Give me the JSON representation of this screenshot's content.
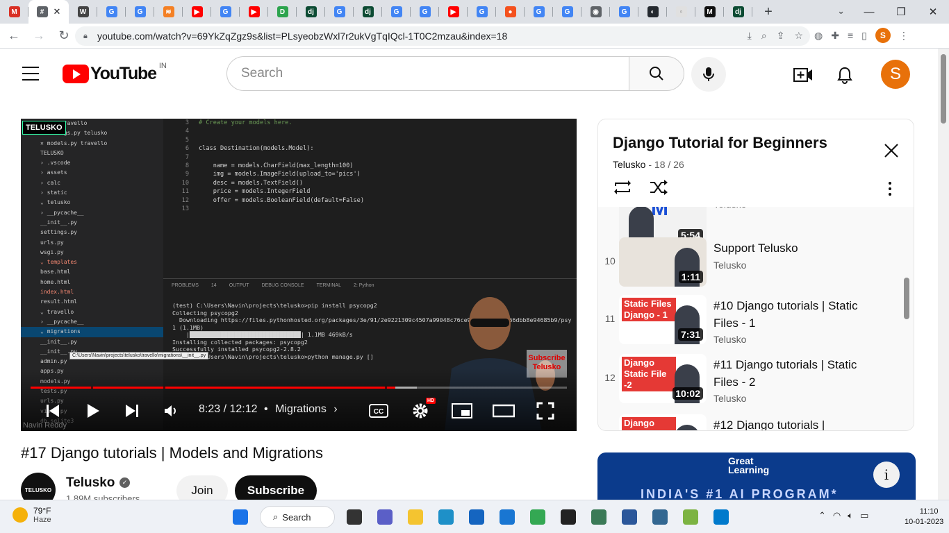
{
  "browser": {
    "tabs": [
      {
        "icon": "gmail-icon",
        "color": "#d93025",
        "glyph": "M"
      },
      {
        "icon": "hash-tab-icon",
        "color": "#5f6368",
        "glyph": "#",
        "active": true
      },
      {
        "icon": "wikipedia-icon",
        "color": "#444444",
        "glyph": "W"
      },
      {
        "icon": "google-icon",
        "color": "#4285f4",
        "glyph": "G"
      },
      {
        "icon": "google-icon",
        "color": "#4285f4",
        "glyph": "G"
      },
      {
        "icon": "stack-icon",
        "color": "#f48024",
        "glyph": "≋"
      },
      {
        "icon": "youtube-icon",
        "color": "#ff0000",
        "glyph": "▶"
      },
      {
        "icon": "google-icon",
        "color": "#4285f4",
        "glyph": "G"
      },
      {
        "icon": "youtube-icon",
        "color": "#ff0000",
        "glyph": "▶"
      },
      {
        "icon": "d-icon",
        "color": "#2da44e",
        "glyph": "D"
      },
      {
        "icon": "django-icon",
        "color": "#0c4b33",
        "glyph": "dj"
      },
      {
        "icon": "google-icon",
        "color": "#4285f4",
        "glyph": "G"
      },
      {
        "icon": "django-icon",
        "color": "#0c4b33",
        "glyph": "dj"
      },
      {
        "icon": "google-icon",
        "color": "#4285f4",
        "glyph": "G"
      },
      {
        "icon": "google-icon",
        "color": "#4285f4",
        "glyph": "G"
      },
      {
        "icon": "youtube-icon",
        "color": "#ff0000",
        "glyph": "▶"
      },
      {
        "icon": "google-icon",
        "color": "#4285f4",
        "glyph": "G"
      },
      {
        "icon": "orange-icon",
        "color": "#f4511e",
        "glyph": "●"
      },
      {
        "icon": "google-icon",
        "color": "#4285f4",
        "glyph": "G"
      },
      {
        "icon": "google-icon",
        "color": "#4285f4",
        "glyph": "G"
      },
      {
        "icon": "globe-icon",
        "color": "#5f6368",
        "glyph": "◉"
      },
      {
        "icon": "google-icon",
        "color": "#4285f4",
        "glyph": "G"
      },
      {
        "icon": "github-icon",
        "color": "#24292f",
        "glyph": "◐"
      },
      {
        "icon": "blank-page-icon",
        "color": "#e0e0e0",
        "glyph": "▫"
      },
      {
        "icon": "medium-icon",
        "color": "#111111",
        "glyph": "M"
      },
      {
        "icon": "django-icon",
        "color": "#0c4b33",
        "glyph": "dj"
      }
    ],
    "active_tab_text": "#",
    "url": "youtube.com/watch?v=69YkZqZgz9s&list=PLsyeobzWxl7r2ukVgTqIQcl-1T0C2mzau&index=18",
    "profile_letter": "S"
  },
  "youtube": {
    "wordmark": "YouTube",
    "country": "IN",
    "search_placeholder": "Search",
    "avatar_letter": "S"
  },
  "video": {
    "title": "#17 Django tutorials | Models and Migrations",
    "time": "8:23 / 12:12",
    "chapter_sep": "•",
    "chapter": "Migrations",
    "hd": "HD",
    "progress_played": 0.68,
    "progress_loaded": 0.72,
    "chapter_marks": [
      0.113,
      0.247,
      0.66
    ],
    "channel_tag": "TELUSKO",
    "subscribe_overlay": "Subscribe Telusko",
    "watermark": "Navin Reddy",
    "explorer": [
      {
        "t": "…s.py  travello",
        "c": ""
      },
      {
        "t": "…settings.py  telusko",
        "c": ""
      },
      {
        "t": "✕  models.py  travello",
        "c": ""
      },
      {
        "t": "TELUSKO",
        "c": ""
      },
      {
        "t": "› .vscode",
        "c": ""
      },
      {
        "t": "› assets",
        "c": ""
      },
      {
        "t": "› calc",
        "c": ""
      },
      {
        "t": "› static",
        "c": ""
      },
      {
        "t": "⌄ telusko",
        "c": ""
      },
      {
        "t": "   › __pycache__",
        "c": ""
      },
      {
        "t": "   __init__.py",
        "c": ""
      },
      {
        "t": "   settings.py",
        "c": ""
      },
      {
        "t": "   urls.py",
        "c": ""
      },
      {
        "t": "   wsgi.py",
        "c": ""
      },
      {
        "t": "⌄ templates",
        "c": "red"
      },
      {
        "t": "   base.html",
        "c": ""
      },
      {
        "t": "   home.html",
        "c": ""
      },
      {
        "t": "   index.html",
        "c": "red"
      },
      {
        "t": "   result.html",
        "c": ""
      },
      {
        "t": "⌄ travello",
        "c": ""
      },
      {
        "t": "   › __pycache__",
        "c": ""
      },
      {
        "t": "   ⌄ migrations",
        "c": "sel"
      },
      {
        "t": "      __init__.py",
        "c": ""
      },
      {
        "t": "   __init__.py",
        "c": ""
      },
      {
        "t": "   admin.py",
        "c": ""
      },
      {
        "t": "   apps.py",
        "c": ""
      },
      {
        "t": "   models.py",
        "c": ""
      },
      {
        "t": "   tests.py",
        "c": ""
      },
      {
        "t": "   urls.py",
        "c": ""
      },
      {
        "t": "   views.py",
        "c": ""
      },
      {
        "t": "   db.sqlite3",
        "c": ""
      }
    ],
    "code": [
      {
        "n": "3",
        "t": "# Create your models here."
      },
      {
        "n": "4",
        "t": ""
      },
      {
        "n": "5",
        "t": ""
      },
      {
        "n": "6",
        "t": "class Destination(models.Model):"
      },
      {
        "n": "7",
        "t": ""
      },
      {
        "n": "8",
        "t": "    name = models.CharField(max_length=100)"
      },
      {
        "n": "9",
        "t": "    img = models.ImageField(upload_to='pics')"
      },
      {
        "n": "10",
        "t": "    desc = models.TextField()"
      },
      {
        "n": "11",
        "t": "    price = models.IntegerField"
      },
      {
        "n": "12",
        "t": "    offer = models.BooleanField(default=False)"
      },
      {
        "n": "13",
        "t": ""
      }
    ],
    "panel_tabs": [
      "PROBLEMS",
      "14",
      "OUTPUT",
      "DEBUG CONSOLE",
      "TERMINAL",
      "2: Python"
    ],
    "terminal": [
      "(test) C:\\Users\\Navin\\projects\\telusko>pip install psycopg2",
      "Collecting psycopg2",
      "  Downloading https://files.pythonhosted.org/packages/3e/91/2e9221309c4507a99048c76ce97b6d2a…df0b66dbb8e94685b9/psy",
      "1 (1.1MB)",
      "    |████████████████████████████████| 1.1MB 469kB/s",
      "Installing collected packages: psycopg2",
      "Successfully installed psycopg2-2.8.2",
      "(test) C:\\Users\\Navin\\projects\\telusko>python manage.py []"
    ],
    "tooltip": "C:\\Users\\Navin\\projects\\telusko\\travello\\migrations\\__init__.py"
  },
  "channel": {
    "avatar_text": "TELUSKO",
    "name": "Telusko",
    "subscribers": "1.89M subscribers",
    "join": "Join",
    "subscribe": "Subscribe"
  },
  "playlist": {
    "title": "Django Tutorial for Beginners",
    "owner": "Telusko",
    "sep": " - ",
    "position": "18 / 26",
    "items": [
      {
        "index": "",
        "title": "",
        "channel": "Telusko",
        "duration": "5:54",
        "thumb_color": "#f2f2f2",
        "thumb_text": "M"
      },
      {
        "index": "10",
        "title": "Support Telusko",
        "channel": "Telusko",
        "duration": "1:11",
        "thumb_color": "#e8e3dc",
        "thumb_text": ""
      },
      {
        "index": "11",
        "title": "#10 Django tutorials | Static Files - 1",
        "channel": "Telusko",
        "duration": "7:31",
        "thumb_color": "#ffffff",
        "thumb_text": "Static Files Django - 1"
      },
      {
        "index": "12",
        "title": "#11 Django tutorials | Static Files - 2",
        "channel": "Telusko",
        "duration": "10:02",
        "thumb_color": "#ffffff",
        "thumb_text": "Django Static File -2"
      },
      {
        "index": "",
        "title": "#12 Django tutorials |",
        "channel": "",
        "duration": "",
        "thumb_color": "#ffffff",
        "thumb_text": "Django Tutorial Passing"
      }
    ]
  },
  "ad": {
    "brand_line1": "Great",
    "brand_line2": "Learning",
    "tagline": "INDIA'S #1 AI PROGRAM*",
    "info": "i"
  },
  "taskbar": {
    "temp": "79°F",
    "condition": "Haze",
    "search": "Search",
    "time": "11:10",
    "date": "10-01-2023",
    "apps": [
      {
        "icon": "windows-start-icon",
        "color": "#1a73e8"
      },
      {
        "icon": "task-view-icon",
        "color": "#333333"
      },
      {
        "icon": "teams-chat-icon",
        "color": "#5b5fc7"
      },
      {
        "icon": "file-explorer-icon",
        "color": "#f4c430"
      },
      {
        "icon": "edge-icon",
        "color": "#1e90c8"
      },
      {
        "icon": "store-icon",
        "color": "#1565c0"
      },
      {
        "icon": "mail-icon",
        "color": "#1976d2"
      },
      {
        "icon": "chrome-icon",
        "color": "#34a853"
      },
      {
        "icon": "terminal-icon",
        "color": "#222222"
      },
      {
        "icon": "layers-icon",
        "color": "#3b7a57"
      },
      {
        "icon": "word-icon",
        "color": "#2b579a"
      },
      {
        "icon": "postgres-icon",
        "color": "#336791"
      },
      {
        "icon": "arrow-app-icon",
        "color": "#7cb342"
      },
      {
        "icon": "vscode-icon",
        "color": "#007acc"
      }
    ]
  }
}
